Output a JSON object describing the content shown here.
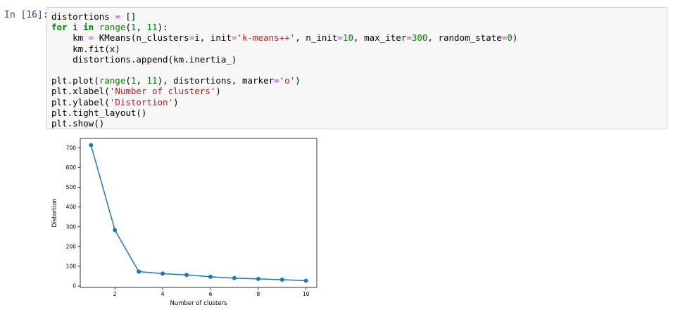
{
  "cell": {
    "prompt": "In [16]:",
    "code_lines": [
      [
        {
          "t": "distortions "
        },
        {
          "t": "=",
          "c": "op"
        },
        {
          "t": " []"
        }
      ],
      [
        {
          "t": "for",
          "c": "kw"
        },
        {
          "t": " i "
        },
        {
          "t": "in",
          "c": "kw"
        },
        {
          "t": " "
        },
        {
          "t": "range",
          "c": "bi"
        },
        {
          "t": "("
        },
        {
          "t": "1",
          "c": "num"
        },
        {
          "t": ", "
        },
        {
          "t": "11",
          "c": "num"
        },
        {
          "t": "):"
        }
      ],
      [
        {
          "t": "    km "
        },
        {
          "t": "=",
          "c": "op"
        },
        {
          "t": " KMeans(n_clusters"
        },
        {
          "t": "=",
          "c": "op"
        },
        {
          "t": "i, init"
        },
        {
          "t": "=",
          "c": "op"
        },
        {
          "t": "'k-means++'",
          "c": "str"
        },
        {
          "t": ", n_init"
        },
        {
          "t": "=",
          "c": "op"
        },
        {
          "t": "10",
          "c": "num"
        },
        {
          "t": ", max_iter"
        },
        {
          "t": "=",
          "c": "op"
        },
        {
          "t": "300",
          "c": "num"
        },
        {
          "t": ", random_state"
        },
        {
          "t": "=",
          "c": "op"
        },
        {
          "t": "0",
          "c": "num"
        },
        {
          "t": ")"
        }
      ],
      [
        {
          "t": "    km.fit(x)"
        }
      ],
      [
        {
          "t": "    distortions.append(km.inertia_)"
        }
      ],
      [
        {
          "t": ""
        }
      ],
      [
        {
          "t": "plt.plot("
        },
        {
          "t": "range",
          "c": "bi"
        },
        {
          "t": "("
        },
        {
          "t": "1",
          "c": "num"
        },
        {
          "t": ", "
        },
        {
          "t": "11",
          "c": "num"
        },
        {
          "t": "), distortions, marker"
        },
        {
          "t": "=",
          "c": "op"
        },
        {
          "t": "'o'",
          "c": "str"
        },
        {
          "t": ")"
        }
      ],
      [
        {
          "t": "plt.xlabel("
        },
        {
          "t": "'Number of clusters'",
          "c": "str"
        },
        {
          "t": ")"
        }
      ],
      [
        {
          "t": "plt.ylabel("
        },
        {
          "t": "'Distortion'",
          "c": "str"
        },
        {
          "t": ")"
        }
      ],
      [
        {
          "t": "plt.tight_layout()"
        }
      ],
      [
        {
          "t": "plt.show()"
        }
      ]
    ]
  },
  "chart_data": {
    "type": "line",
    "x": [
      1,
      2,
      3,
      4,
      5,
      6,
      7,
      8,
      9,
      10
    ],
    "series": [
      {
        "values": [
          713,
          283,
          73,
          63,
          56,
          47,
          40,
          36,
          32,
          27
        ],
        "color": "#1f77b4",
        "marker": "o"
      }
    ],
    "xlabel": "Number of clusters",
    "ylabel": "Distortion",
    "xticks": [
      2,
      4,
      6,
      8,
      10
    ],
    "yticks": [
      0,
      100,
      200,
      300,
      400,
      500,
      600,
      700
    ],
    "xlim": [
      0.55,
      10.45
    ],
    "ylim": [
      -7,
      747
    ],
    "grid": false
  }
}
